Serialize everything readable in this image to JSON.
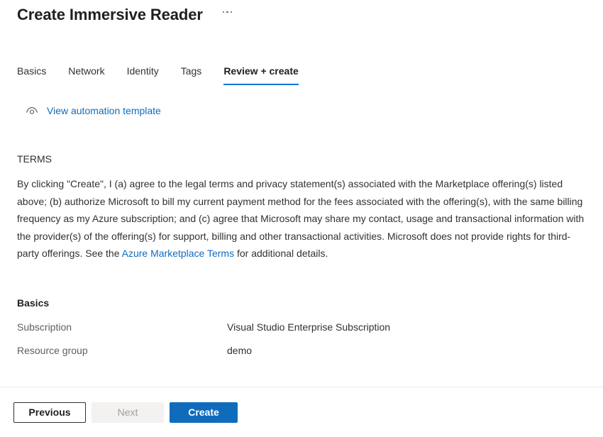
{
  "blade": {
    "title": "Create Immersive Reader",
    "more_menu_icon": "ellipsis-icon"
  },
  "tabs": [
    {
      "label": "Basics",
      "selected": false
    },
    {
      "label": "Network",
      "selected": false
    },
    {
      "label": "Identity",
      "selected": false
    },
    {
      "label": "Tags",
      "selected": false
    },
    {
      "label": "Review + create",
      "selected": true
    }
  ],
  "automation": {
    "icon": "eye-icon",
    "label": "View automation template"
  },
  "terms": {
    "heading": "TERMS",
    "body_part_1": "By clicking \"Create\", I (a) agree to the legal terms and privacy statement(s) associated with the Marketplace offering(s) listed above; (b) authorize Microsoft to bill my current payment method for the fees associated with the offering(s), with the same billing frequency as my Azure subscription; and (c) agree that Microsoft may share my contact, usage and transactional information with the provider(s) of the offering(s) for support, billing and other transactional activities. Microsoft does not provide rights for third-party offerings. See the ",
    "link_text": "Azure Marketplace Terms",
    "body_part_2": " for additional details."
  },
  "basics": {
    "heading": "Basics",
    "rows": [
      {
        "key": "Subscription",
        "value": "Visual Studio Enterprise Subscription"
      },
      {
        "key": "Resource group",
        "value": "demo"
      }
    ]
  },
  "footer": {
    "previous_label": "Previous",
    "next_label": "Next",
    "create_label": "Create"
  },
  "colors": {
    "accent": "#0078d4",
    "link": "#0f6cbd",
    "primary_button": "#0f6cbd",
    "disabled_button_bg": "#f3f2f1",
    "disabled_button_text": "#a19f9d",
    "text": "#323130",
    "muted_text": "#605e5c",
    "divider": "#edebe9"
  }
}
